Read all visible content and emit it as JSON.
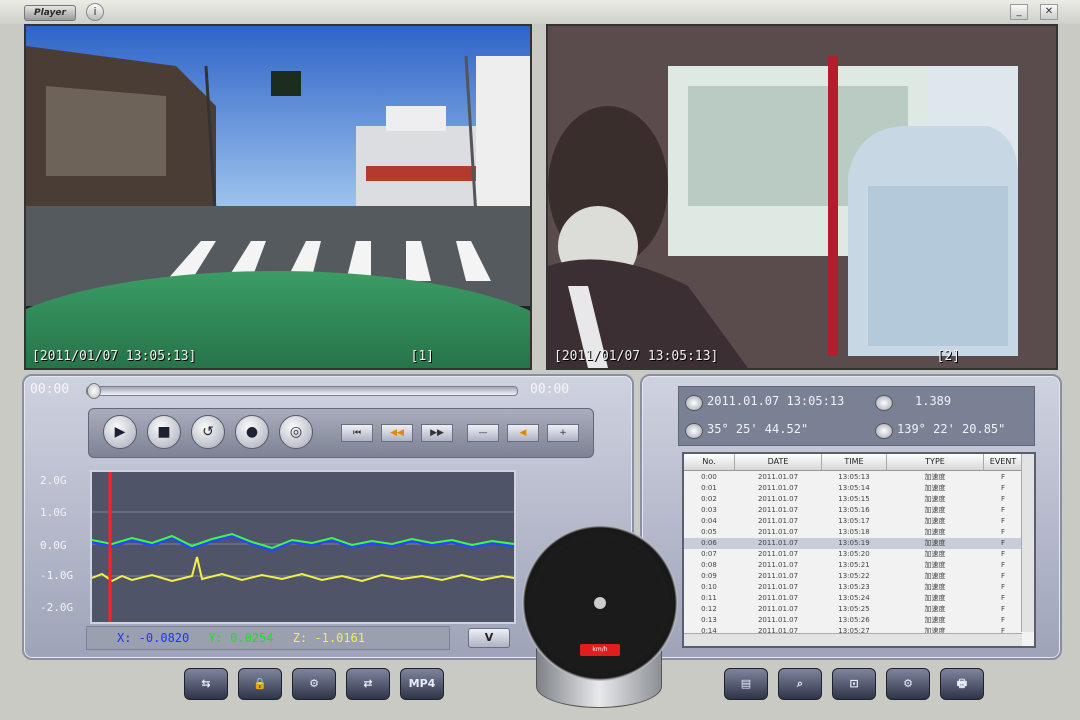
{
  "titlebar": {
    "logo": "Player",
    "info": "i",
    "minimize": "_",
    "close": "✕"
  },
  "videos": {
    "left": {
      "caption": "[2011/01/07 13:05:13]",
      "channel": "[1]"
    },
    "right": {
      "caption": "[2011/01/07 13:05:13]",
      "channel": "[2]"
    }
  },
  "playback": {
    "time_start": "00:00",
    "time_end": "00:00",
    "progress": 0.0
  },
  "controls": {
    "play": "▶",
    "stop": "■",
    "open": "↺",
    "record": "●",
    "snapshot": "◎",
    "small_buttons": [
      "⏮",
      "◀◀",
      "▶▶",
      "—",
      "◀",
      "+"
    ]
  },
  "graph": {
    "y_labels": [
      "2.0G",
      "1.0G",
      "0.0G",
      "-1.0G",
      "-2.0G"
    ]
  },
  "accel": {
    "x": "X: -0.0820",
    "y": "Y: 0.0254",
    "z": "Z: -1.0161",
    "v_button": "V"
  },
  "gps": {
    "datetime": "2011.01.07  13:05:13",
    "speed": "1.389",
    "lat": "35°  25'  44.52\"",
    "lon": "139°  22'  20.85\""
  },
  "table": {
    "headers": [
      "No.",
      "DATE",
      "TIME",
      "TYPE",
      "EVENT"
    ],
    "rows": [
      [
        "0:00",
        "2011.01.07",
        "13:05:13",
        "加速度",
        "F"
      ],
      [
        "0:01",
        "2011.01.07",
        "13:05:14",
        "加速度",
        "F"
      ],
      [
        "0:02",
        "2011.01.07",
        "13:05:15",
        "加速度",
        "F"
      ],
      [
        "0:03",
        "2011.01.07",
        "13:05:16",
        "加速度",
        "F"
      ],
      [
        "0:04",
        "2011.01.07",
        "13:05:17",
        "加速度",
        "F"
      ],
      [
        "0:05",
        "2011.01.07",
        "13:05:18",
        "加速度",
        "F"
      ],
      [
        "0:06",
        "2011.01.07",
        "13:05:19",
        "加速度",
        "F"
      ],
      [
        "0:07",
        "2011.01.07",
        "13:05:20",
        "加速度",
        "F"
      ],
      [
        "0:08",
        "2011.01.07",
        "13:05:21",
        "加速度",
        "F"
      ],
      [
        "0:09",
        "2011.01.07",
        "13:05:22",
        "加速度",
        "F"
      ],
      [
        "0:10",
        "2011.01.07",
        "13:05:23",
        "加速度",
        "F"
      ],
      [
        "0:11",
        "2011.01.07",
        "13:05:24",
        "加速度",
        "F"
      ],
      [
        "0:12",
        "2011.01.07",
        "13:05:25",
        "加速度",
        "F"
      ],
      [
        "0:13",
        "2011.01.07",
        "13:05:26",
        "加速度",
        "F"
      ],
      [
        "0:14",
        "2011.01.07",
        "13:05:27",
        "加速度",
        "F"
      ]
    ]
  },
  "gauge": {
    "label": "km/h"
  },
  "bottom_left_buttons": [
    "⇆",
    "🔒",
    "⚙",
    "⇄",
    "MP4"
  ],
  "bottom_right_buttons": [
    "▤",
    "⌕",
    "⊡",
    "⚙",
    "🖶"
  ],
  "colors": {
    "accent_red": "#e21d1d",
    "trace_green": "#3cff3c",
    "trace_blue": "#2b44ff",
    "trace_yellow": "#f3f04a"
  }
}
